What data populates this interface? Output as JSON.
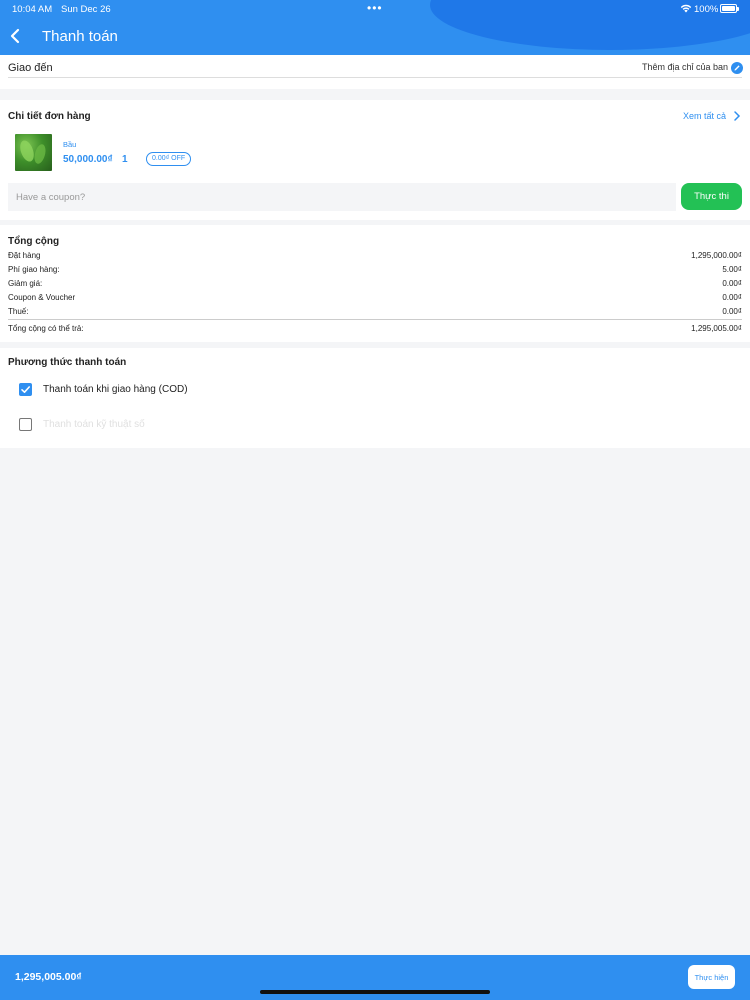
{
  "status_bar": {
    "time": "10:04 AM",
    "date": "Sun Dec 26",
    "dots": "•••",
    "battery": "100%"
  },
  "nav": {
    "back_icon": "chevron-left-icon",
    "title": "Thanh toán"
  },
  "address": {
    "label": "Giao đến",
    "add_link": "Thêm địa chỉ của ban",
    "edit_icon": "edit-icon"
  },
  "order": {
    "title": "Chi tiết đơn hàng",
    "see_all": "Xem tất cả",
    "item": {
      "name": "Bầu",
      "price": "50,000.00₫",
      "quantity": "1",
      "discount_badge": "0.00₫ OFF"
    },
    "coupon_placeholder": "Have a coupon?",
    "apply_label": "Thực thi"
  },
  "totals": {
    "title": "Tổng cộng",
    "rows": [
      {
        "label": "Đặt hàng",
        "value": "1,295,000.00₫"
      },
      {
        "label": "Phí giao hàng:",
        "value": "5.00₫"
      },
      {
        "label": "Giảm giá:",
        "value": "0.00₫"
      },
      {
        "label": "Coupon & Voucher",
        "value": "0.00₫"
      },
      {
        "label": "Thuế:",
        "value": "0.00₫"
      }
    ],
    "grand_label": "Tổng cộng có thể trả:",
    "grand_value": "1,295,005.00₫"
  },
  "payment": {
    "title": "Phương thức thanh toán",
    "options": [
      {
        "label": "Thanh toán khi giao hàng (COD)",
        "checked": true
      },
      {
        "label": "Thanh toán kỹ thuật số",
        "checked": false
      }
    ]
  },
  "bottom_bar": {
    "total": "1,295,005.00₫",
    "submit_label": "Thực hiện"
  },
  "colors": {
    "primary": "#2f8ff0",
    "success": "#23c155"
  }
}
